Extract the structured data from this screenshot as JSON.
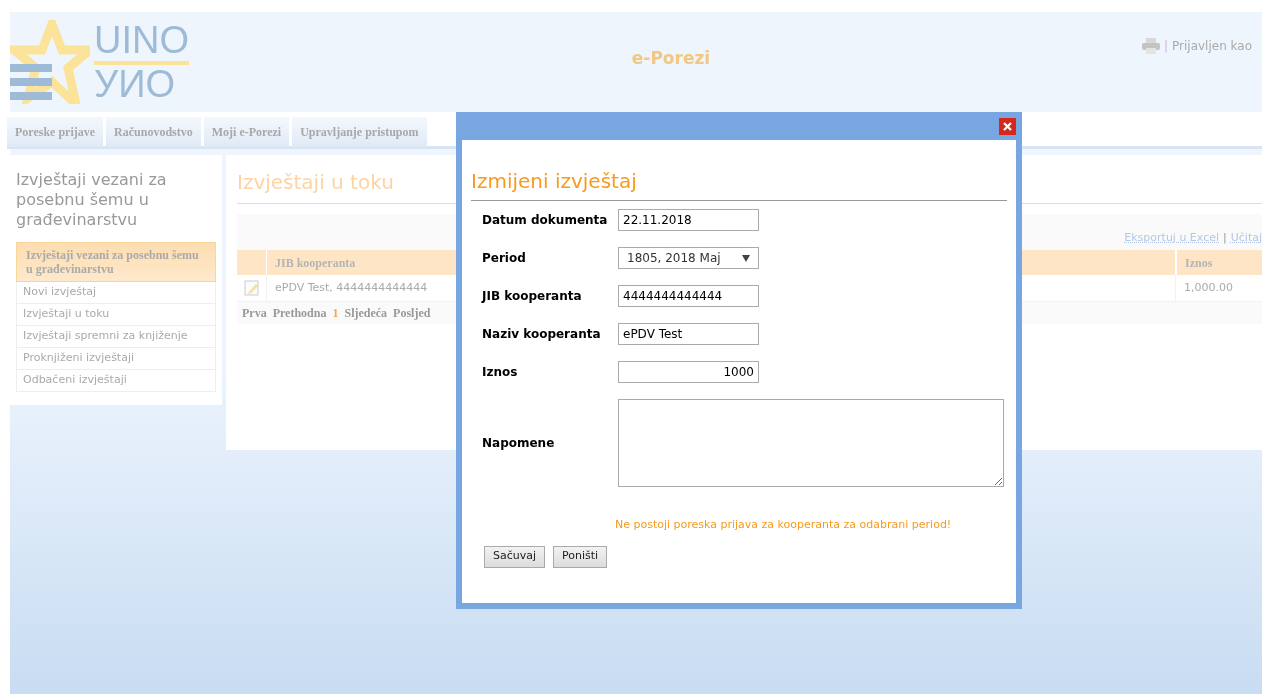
{
  "header": {
    "logo": {
      "line1": "UINO",
      "line2": "УИО"
    },
    "title": "e-Porezi",
    "separator": "|",
    "login": "Prijavljen kao"
  },
  "tabs": [
    {
      "label": "Poreske prijave",
      "selected": false
    },
    {
      "label": "Računovodstvo",
      "selected": false
    },
    {
      "label": "Moji e-Porezi",
      "selected": false
    },
    {
      "label": "Upravljanje pristupom",
      "selected": false
    }
  ],
  "sidebar": {
    "title": "Izvještaji vezani za posebnu šemu u građevinarstvu",
    "section": "Izvještaji vezani za posebnu šemu u građevinarstvu",
    "items": [
      {
        "label": "Novi izvještaj",
        "selected": false
      },
      {
        "label": "Izvještaji u toku",
        "selected": false
      },
      {
        "label": "Izvještaji spremni za knjiženje",
        "selected": false
      },
      {
        "label": "Proknjiženi izvještaji",
        "selected": false
      },
      {
        "label": "Odbačeni izvještaji",
        "selected": false
      }
    ]
  },
  "main": {
    "title": "Izvještaji u toku",
    "links": [
      "Eksportuj u Excel",
      "Učitaj"
    ],
    "link_separator": "|",
    "table": {
      "columns": [
        "JIB kooperanta",
        "Iznos"
      ],
      "rows": [
        {
          "cells": [
            "ePDV Test, 4444444444444",
            "1,000.00"
          ]
        }
      ]
    },
    "pager": [
      {
        "label": "Prva",
        "selected": false
      },
      {
        "label": "Prethodna",
        "selected": false
      },
      {
        "label": "1",
        "selected": true
      },
      {
        "label": "Sljedeća",
        "selected": false
      },
      {
        "label": "Posljed",
        "selected": false
      }
    ]
  },
  "dialog": {
    "title": "Izmijeni izvještaj",
    "fields": [
      {
        "kind": "text",
        "label": "Datum dokumenta",
        "value": "22.11.2018"
      },
      {
        "kind": "select",
        "label": "Period",
        "value": "1805, 2018 Maj"
      },
      {
        "kind": "text",
        "label": "JIB kooperanta",
        "value": "4444444444444"
      },
      {
        "kind": "text",
        "label": "Naziv kooperanta",
        "value": "ePDV Test"
      },
      {
        "kind": "number",
        "label": "Iznos",
        "value": "1000"
      },
      {
        "kind": "textarea",
        "label": "Napomene"
      }
    ],
    "error": "Ne postoji poreska prijava za kooperanta za odabrani period!",
    "buttons": [
      "Sačuvaj",
      "Poništi"
    ]
  }
}
